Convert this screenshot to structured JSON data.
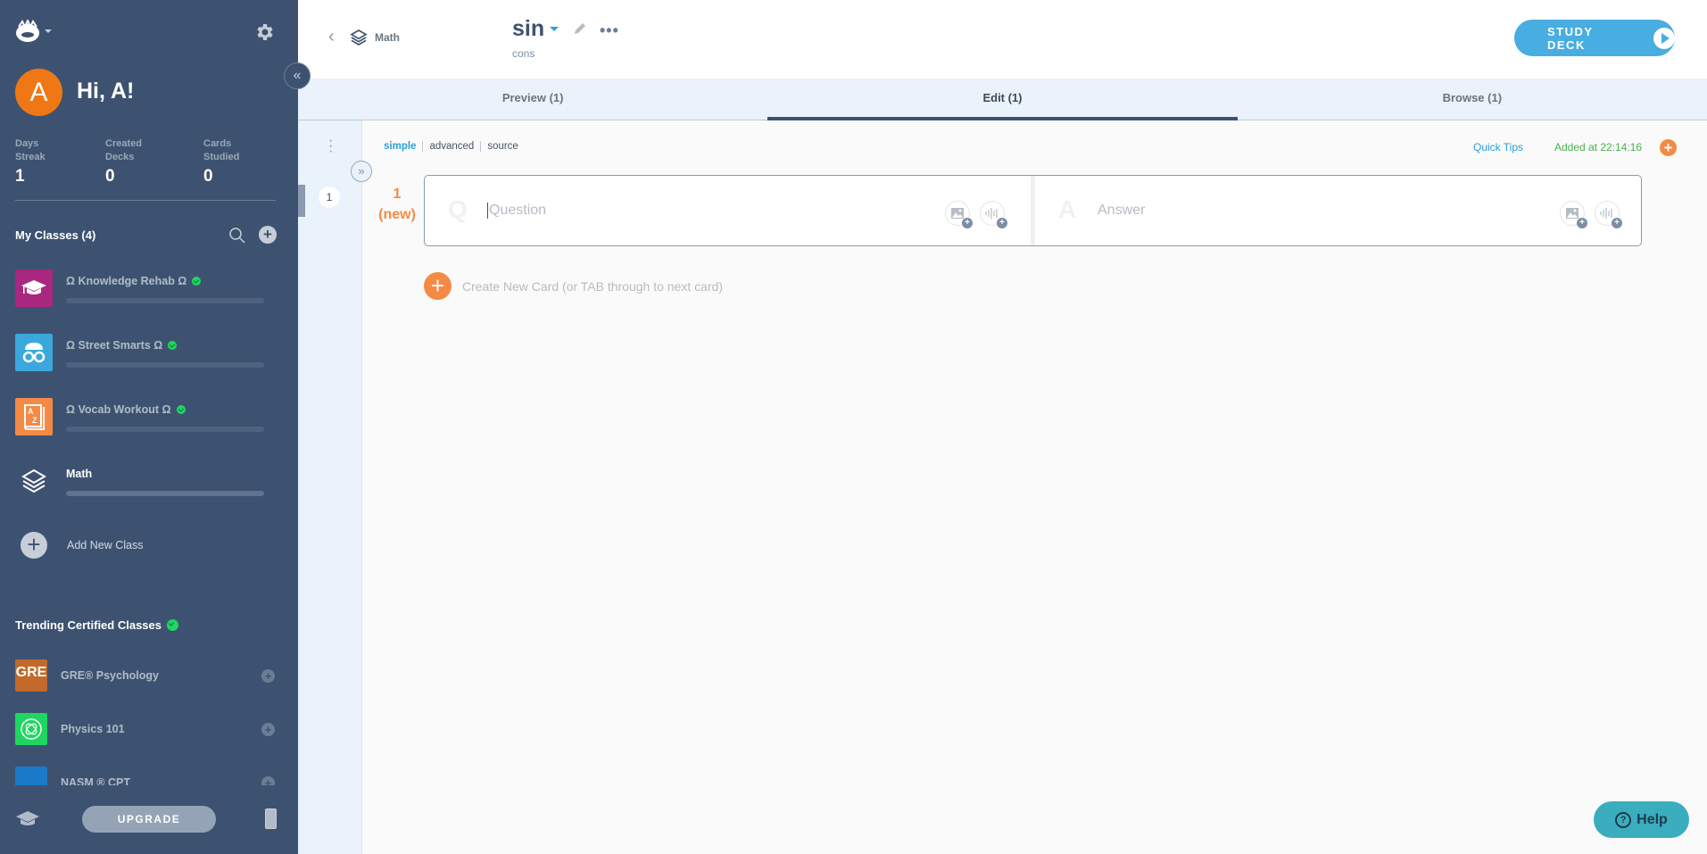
{
  "sidebar": {
    "greeting": "Hi, A!",
    "avatar_initial": "A",
    "stats": [
      {
        "label": "Days Streak",
        "value": "1"
      },
      {
        "label": "Created Decks",
        "value": "0"
      },
      {
        "label": "Cards Studied",
        "value": "0"
      }
    ],
    "my_classes_label": "My Classes  (4)",
    "classes": [
      {
        "name": "Ω Knowledge Rehab Ω",
        "icon": "graduation-cap-icon",
        "color": "#a8287f",
        "certified": true,
        "progress": 0
      },
      {
        "name": "Ω Street Smarts Ω",
        "icon": "brain-glasses-icon",
        "color": "#3aa8dc",
        "certified": true,
        "progress": 0
      },
      {
        "name": "Ω Vocab Workout Ω",
        "icon": "dictionary-icon",
        "color": "#f58a45",
        "certified": true,
        "progress": 0
      },
      {
        "name": "Math",
        "icon": "layers-icon",
        "color": "",
        "certified": false,
        "progress": 0
      }
    ],
    "add_new_class": "Add New Class",
    "trending_label": "Trending Certified Classes",
    "trending": [
      {
        "name": "GRE® Psychology",
        "color": "#c16a2a"
      },
      {
        "name": "Physics 101",
        "color": "#1ed760"
      },
      {
        "name": "NASM ® CPT",
        "color": "#1a7ac8"
      }
    ],
    "upgrade": "UPGRADE"
  },
  "header": {
    "breadcrumb": "Math",
    "deck_title": "sin",
    "deck_subtitle": "cons",
    "study_button": "STUDY DECK"
  },
  "tabs": [
    {
      "label": "Preview (1)",
      "active": false
    },
    {
      "label": "Edit (1)",
      "active": true
    },
    {
      "label": "Browse (1)",
      "active": false
    }
  ],
  "editor": {
    "modes": [
      "simple",
      "advanced",
      "source"
    ],
    "active_mode": "simple",
    "quick_tips": "Quick Tips",
    "added_at": "Added at 22:14:16",
    "card_index": "1",
    "card_number": "1",
    "card_status": "(new)",
    "question_placeholder": "Question",
    "answer_placeholder": "Answer",
    "question_letter": "Q",
    "answer_letter": "A",
    "create_new": "Create New Card (or TAB through to next card)"
  },
  "help": "Help"
}
